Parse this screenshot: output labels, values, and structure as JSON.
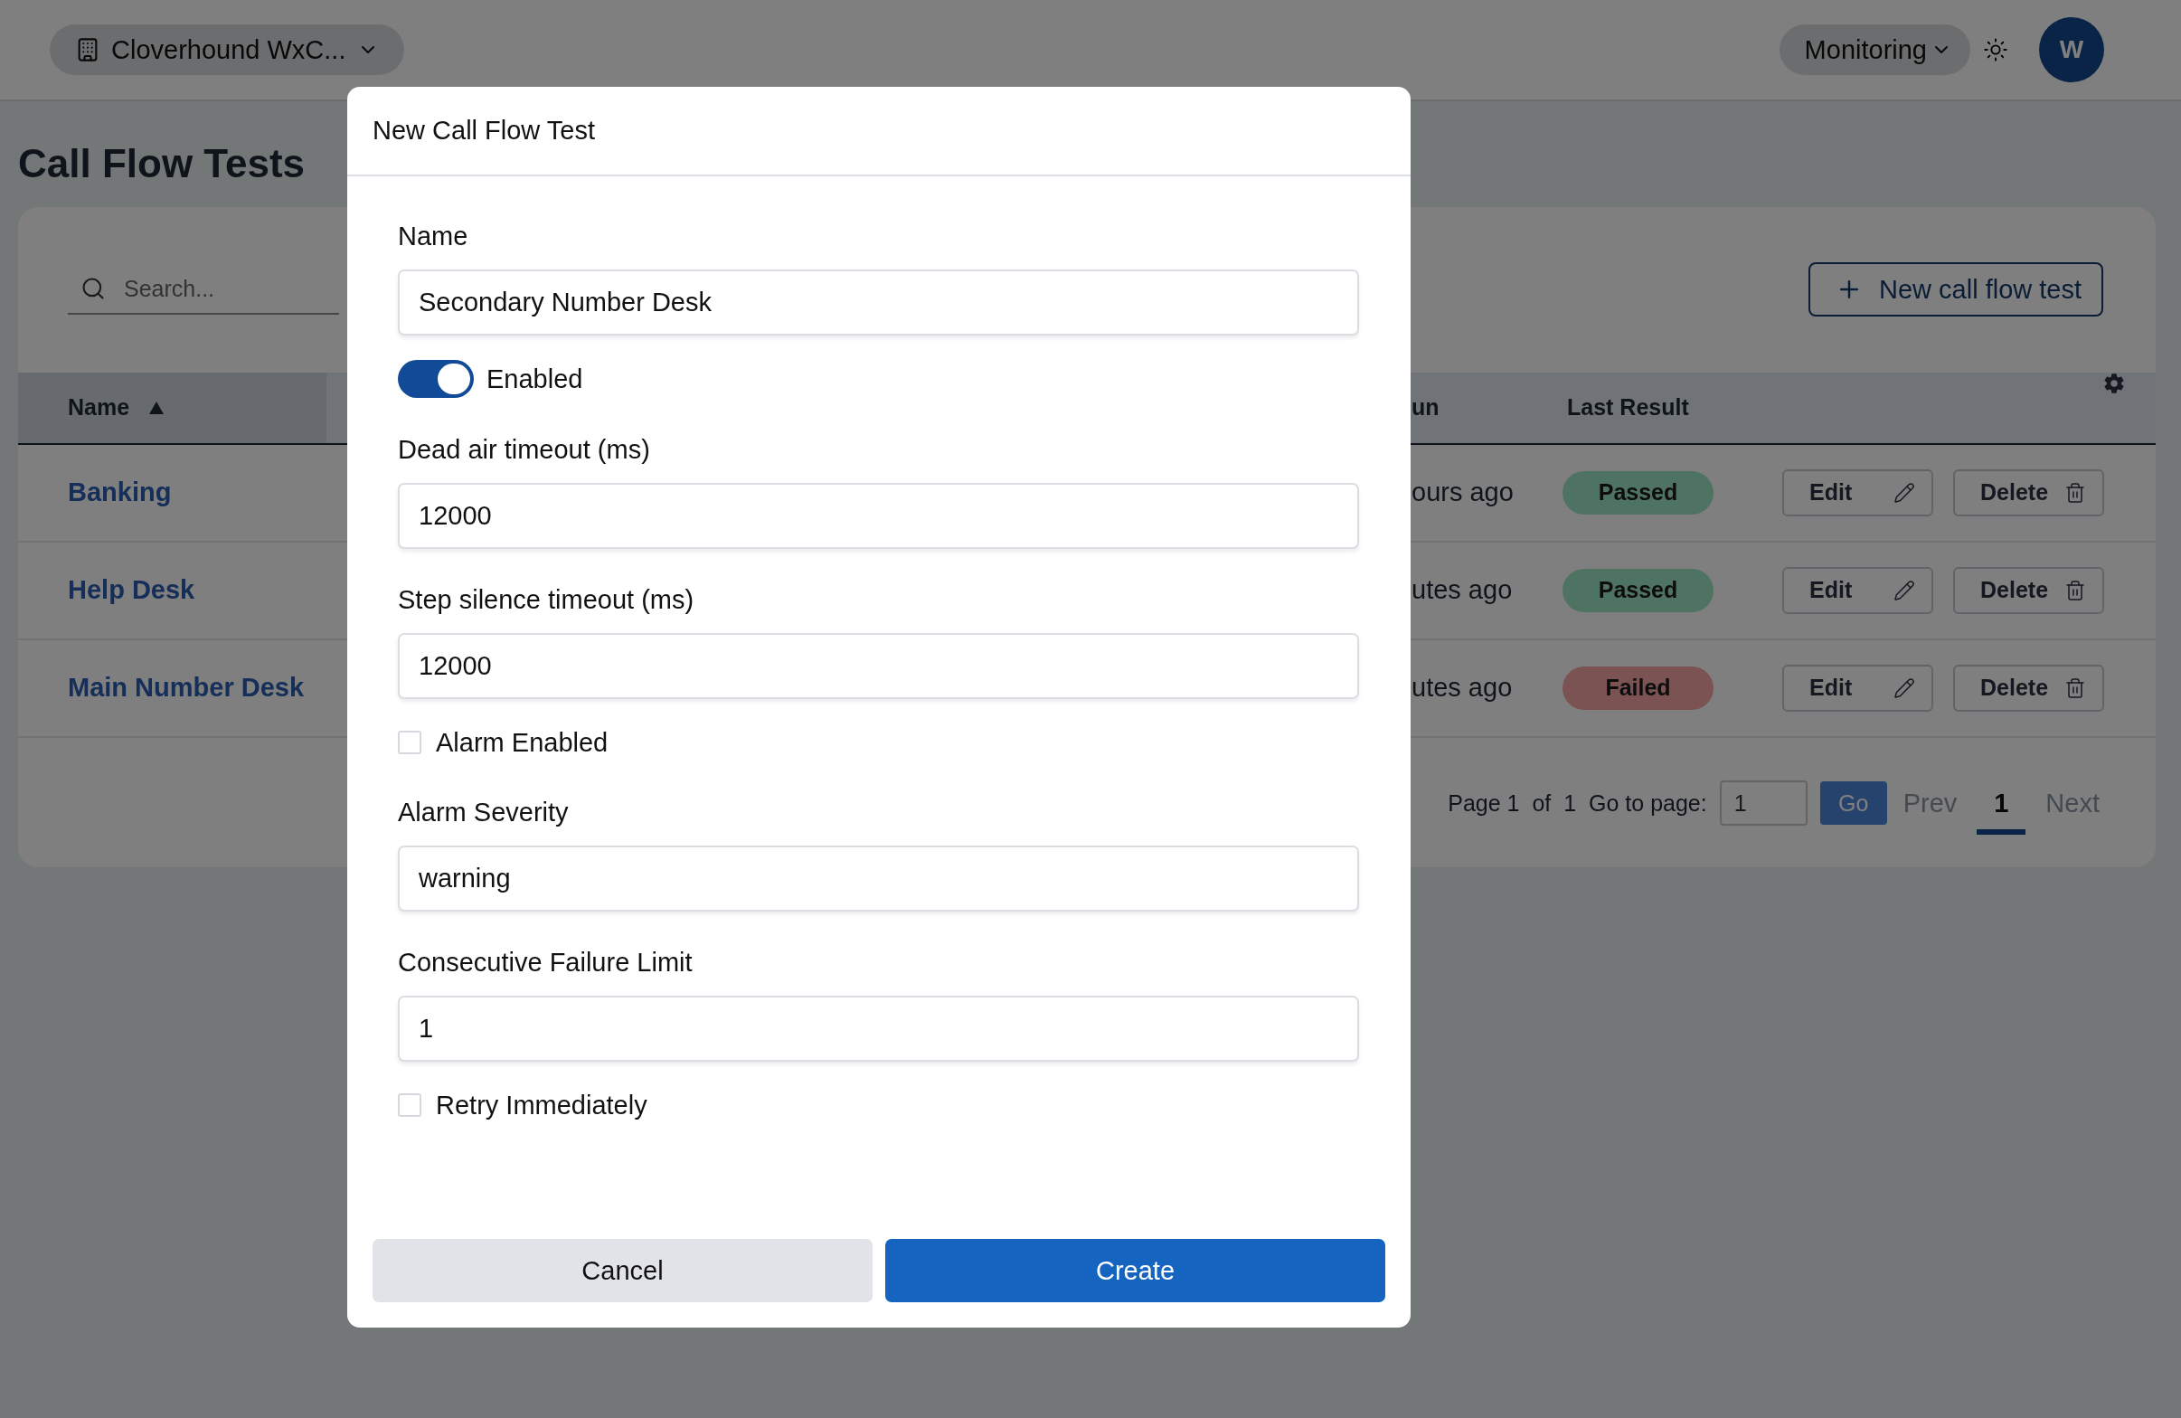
{
  "topbar": {
    "org_selector": "Cloverhound WxC...",
    "nav_menu": "Monitoring",
    "avatar": "W"
  },
  "page": {
    "title": "Call Flow Tests",
    "search": {
      "placeholder": "Search..."
    },
    "new_button": "New call flow test",
    "table": {
      "columns": [
        {
          "label": "Name",
          "sorted": true
        },
        {
          "label": "un",
          "sorted": false
        },
        {
          "label": "Last Result",
          "sorted": false
        }
      ],
      "rows": [
        {
          "name": "Banking",
          "column_2": "ours ago",
          "result": {
            "label": "Passed",
            "kind": "passed"
          },
          "actions": [
            "Edit",
            "Delete"
          ]
        },
        {
          "name": "Help Desk",
          "column_2": "utes ago",
          "result": {
            "label": "Passed",
            "kind": "passed"
          },
          "actions": [
            "Edit",
            "Delete"
          ]
        },
        {
          "name": "Main Number Desk",
          "column_2": "utes ago",
          "result": {
            "label": "Failed",
            "kind": "failed"
          },
          "actions": [
            "Edit",
            "Delete"
          ]
        }
      ]
    },
    "pagination": {
      "summary": "Page 1  of  1",
      "goto_label": "Go to page:",
      "goto_value": "1",
      "go_button": "Go",
      "prev": "Prev",
      "pages": [
        {
          "label": "1",
          "selected": true
        }
      ],
      "next": "Next"
    }
  },
  "modal": {
    "title": "New Call Flow Test",
    "fields": [
      {
        "kind": "text",
        "label": "Name",
        "value": "Secondary Number Desk"
      },
      {
        "kind": "toggle",
        "label": "Enabled",
        "on": true
      },
      {
        "kind": "text",
        "label": "Dead air timeout (ms)",
        "value": "12000"
      },
      {
        "kind": "text",
        "label": "Step silence timeout (ms)",
        "value": "12000"
      },
      {
        "kind": "checkbox",
        "label": "Alarm Enabled",
        "checked": false
      },
      {
        "kind": "text",
        "label": "Alarm Severity",
        "value": "warning"
      },
      {
        "kind": "text",
        "label": "Consecutive Failure Limit",
        "value": "1"
      },
      {
        "kind": "checkbox",
        "label": "Retry Immediately",
        "checked": false
      }
    ],
    "buttons": [
      {
        "label": "Cancel",
        "kind": "secondary"
      },
      {
        "label": "Create",
        "kind": "primary"
      }
    ]
  }
}
